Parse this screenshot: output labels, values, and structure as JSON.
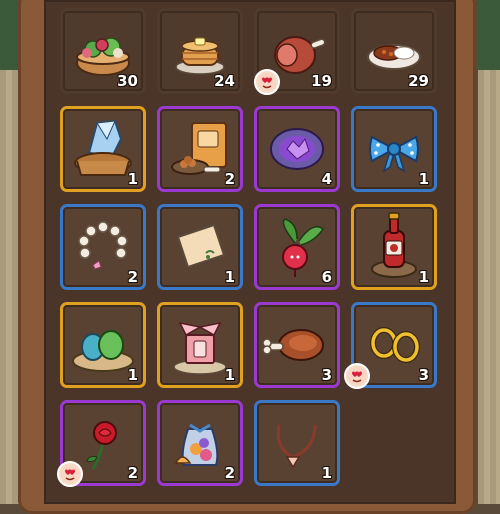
{
  "inventory": {
    "items": [
      {
        "name": "salad-bowl",
        "qty": "30",
        "rarity": "none"
      },
      {
        "name": "pancakes",
        "qty": "24",
        "rarity": "none"
      },
      {
        "name": "ham",
        "qty": "19",
        "rarity": "none",
        "favorite": true
      },
      {
        "name": "curry-rice",
        "qty": "29",
        "rarity": "none"
      },
      {
        "name": "crystal-basket",
        "qty": "1",
        "rarity": "gold"
      },
      {
        "name": "dog-food-bag",
        "qty": "2",
        "rarity": "purple"
      },
      {
        "name": "geode",
        "qty": "4",
        "rarity": "purple"
      },
      {
        "name": "blue-bow",
        "qty": "1",
        "rarity": "blue"
      },
      {
        "name": "pearl-bracelet",
        "qty": "2",
        "rarity": "blue"
      },
      {
        "name": "paper-note",
        "qty": "1",
        "rarity": "blue"
      },
      {
        "name": "radish",
        "qty": "6",
        "rarity": "purple"
      },
      {
        "name": "wine-bottle",
        "qty": "1",
        "rarity": "gold"
      },
      {
        "name": "eggs-nest",
        "qty": "1",
        "rarity": "gold"
      },
      {
        "name": "gift-box",
        "qty": "1",
        "rarity": "gold"
      },
      {
        "name": "meat-bone",
        "qty": "3",
        "rarity": "purple"
      },
      {
        "name": "gold-earrings",
        "qty": "3",
        "rarity": "blue",
        "favorite": true
      },
      {
        "name": "red-rose",
        "qty": "2",
        "rarity": "purple",
        "favorite": true
      },
      {
        "name": "treat-bag",
        "qty": "2",
        "rarity": "purple"
      },
      {
        "name": "shell-necklace",
        "qty": "1",
        "rarity": "blue"
      }
    ]
  },
  "colors": {
    "gold": "#e0a020",
    "purple": "#9a3ad0",
    "blue": "#3a78c8",
    "panel": "#4a3528"
  }
}
